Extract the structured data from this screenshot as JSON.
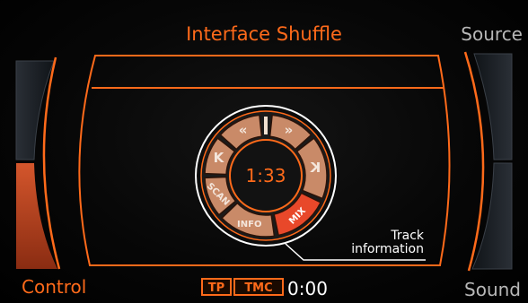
{
  "header": {
    "title": "Interface Shuffle",
    "source_label": "Source"
  },
  "footer": {
    "control_label": "Control",
    "sound_label": "Sound",
    "tp_badge": "TP",
    "tmc_badge": "TMC",
    "clock": "0:00"
  },
  "wheel": {
    "time": "1:33",
    "buttons": {
      "rewind": "«",
      "forward": "»",
      "prev": "K",
      "next": "K",
      "scan": "SCAN",
      "info": "INFO",
      "mix": "MIX"
    }
  },
  "track_info": {
    "line1": "Track",
    "line2": "information"
  },
  "colors": {
    "accent": "#ff6a1a",
    "mix_active": "#e8482a",
    "button": "#c98a68"
  }
}
